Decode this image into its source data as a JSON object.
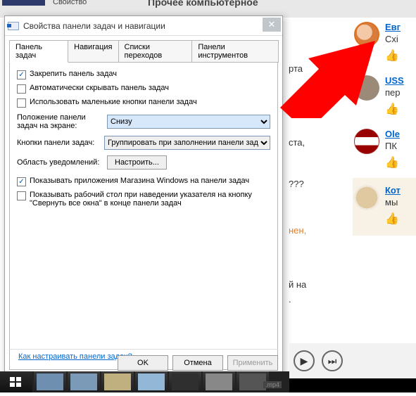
{
  "bg": {
    "tab_label": "Свойство",
    "heading": "Прочее компьютерное",
    "snips": [
      "рта",
      "ста,",
      "???",
      "нен,",
      "й на",
      "."
    ]
  },
  "comments": [
    {
      "user": "Евг",
      "text": "Схі",
      "avatar": "av1"
    },
    {
      "user": "USS",
      "text": "пер",
      "avatar": "av2"
    },
    {
      "user": "Ole",
      "text": "ПК",
      "avatar": "av3"
    },
    {
      "user": "Кот",
      "text": "мы",
      "avatar": "av4"
    }
  ],
  "dialog": {
    "title": "Свойства панели задач и навигации",
    "tabs": [
      "Панель задач",
      "Навигация",
      "Списки переходов",
      "Панели инструментов"
    ],
    "active_tab": 0,
    "chk_lock": {
      "checked": true,
      "label": "Закрепить панель задач"
    },
    "chk_autohide": {
      "checked": false,
      "label": "Автоматически скрывать панель задач"
    },
    "chk_small": {
      "checked": false,
      "label": "Использовать маленькие кнопки панели задач"
    },
    "pos_label": "Положение панели задач на экране:",
    "pos_value": "Снизу",
    "btns_label": "Кнопки панели задач:",
    "btns_value": "Группировать при заполнении панели зад",
    "notif_label": "Область уведомлений:",
    "notif_btn": "Настроить...",
    "chk_store": {
      "checked": true,
      "label": "Показывать приложения Магазина Windows на панели задач"
    },
    "chk_peek": {
      "checked": false,
      "label": "Показывать рабочий стол при наведении указателя на кнопку \"Свернуть все окна\" в конце панели задач"
    },
    "help_link": "Как настраивать панели задач?",
    "ok": "OK",
    "cancel": "Отмена",
    "apply": "Применить"
  },
  "media": {
    "mp4": ".mp4"
  }
}
